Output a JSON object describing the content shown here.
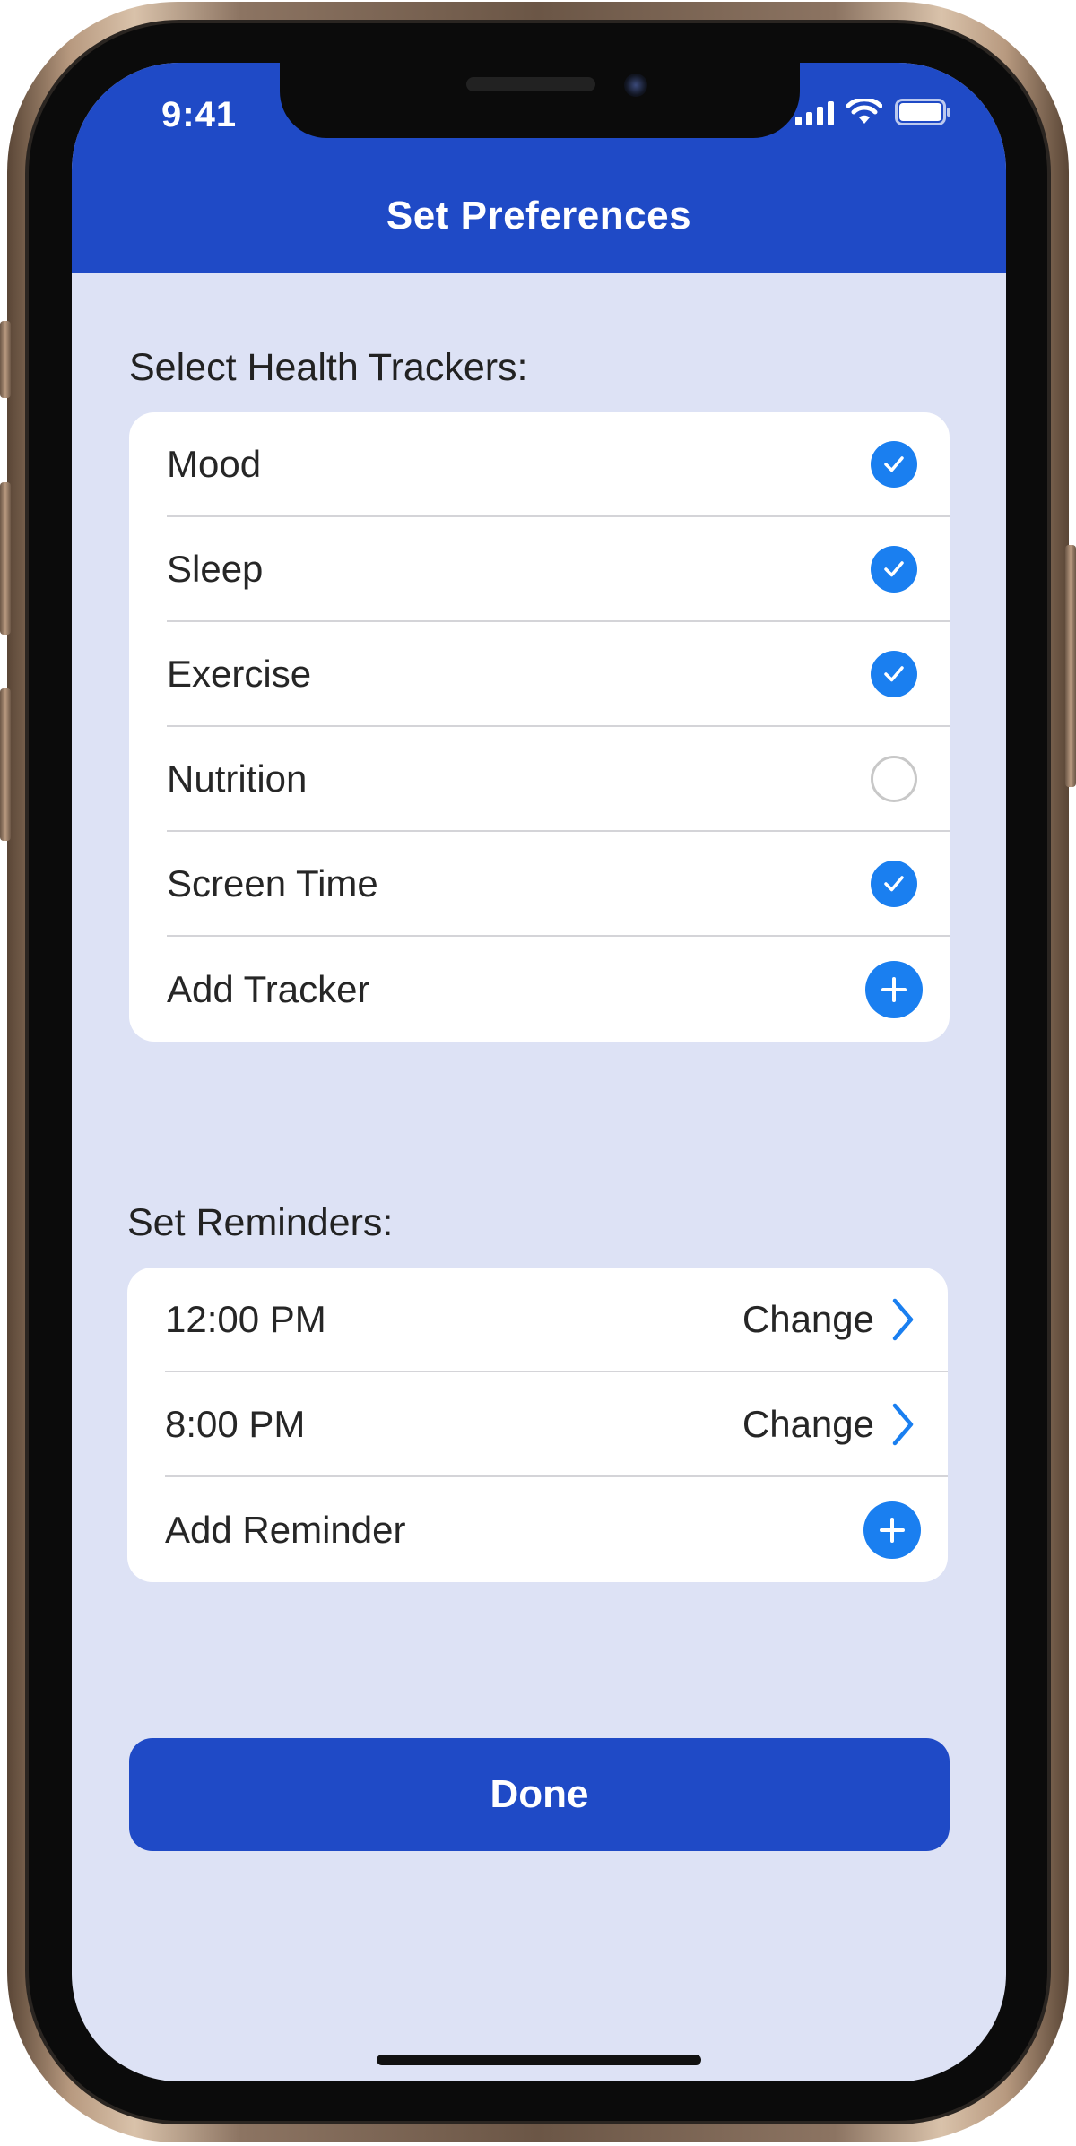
{
  "status_bar": {
    "time": "9:41",
    "icons": [
      "cellular-signal-icon",
      "wifi-icon",
      "battery-icon"
    ]
  },
  "header": {
    "title": "Set Preferences"
  },
  "trackers": {
    "label": "Select Health Trackers:",
    "items": [
      {
        "label": "Mood",
        "checked": true
      },
      {
        "label": "Sleep",
        "checked": true
      },
      {
        "label": "Exercise",
        "checked": true
      },
      {
        "label": "Nutrition",
        "checked": false
      },
      {
        "label": "Screen Time",
        "checked": true
      }
    ],
    "add_label": "Add Tracker"
  },
  "reminders": {
    "label": "Set Reminders:",
    "items": [
      {
        "time": "12:00 PM",
        "action": "Change"
      },
      {
        "time": "8:00 PM",
        "action": "Change"
      }
    ],
    "add_label": "Add Reminder"
  },
  "done_label": "Done",
  "colors": {
    "primary": "#1f4ac6",
    "accent": "#1a7ff0",
    "background": "#dde2f5"
  }
}
